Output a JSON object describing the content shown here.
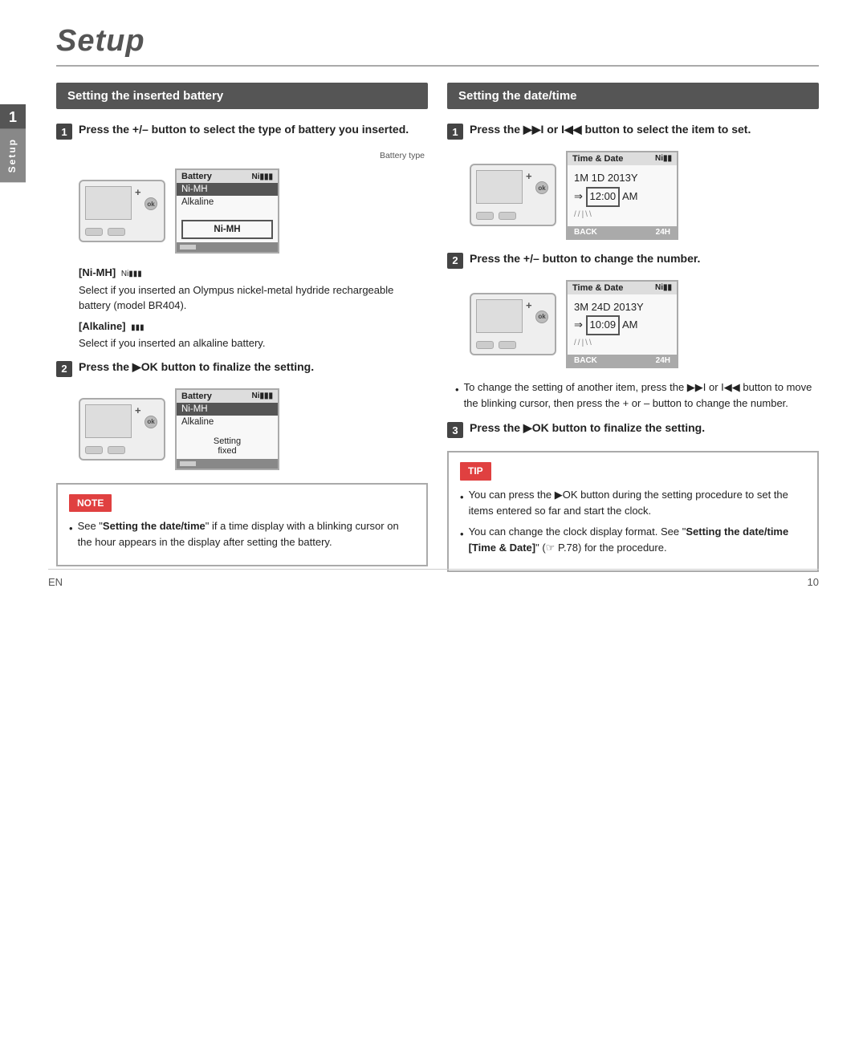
{
  "page": {
    "title": "Setup",
    "footer_lang": "EN",
    "footer_page": "10"
  },
  "side_tab": {
    "label": "Setup",
    "number": "1"
  },
  "left_section": {
    "header": "Setting the inserted battery",
    "step1": {
      "num": "1",
      "text": "Press the +/– button to select the type of battery you inserted."
    },
    "battery_type_label": "Battery type",
    "menu1": {
      "header": "Battery",
      "battery_icon": "Ni▮▮▮",
      "row1": "Ni-MH",
      "row2": "Alkaline",
      "highlighted": "Ni-MH"
    },
    "nimh_term": "[Ni-MH]",
    "nimh_icon": "Ni▮▮▮",
    "nimh_desc": "Select if you inserted an Olympus nickel-metal hydride rechargeable battery (model BR404).",
    "alkaline_term": "[Alkaline]",
    "alkaline_icon": "▮▮▮",
    "alkaline_desc": "Select if you inserted an alkaline battery.",
    "step2": {
      "num": "2",
      "text": "Press the ▶OK button to finalize the setting."
    },
    "menu2": {
      "header": "Battery",
      "battery_icon": "Ni▮▮▮",
      "row1": "Ni-MH",
      "row2": "Alkaline",
      "row3": "Setting",
      "row4": "fixed"
    },
    "note_label": "NOTE",
    "note_text": "See \"Setting the date/time\" if a time display with a blinking cursor on the hour appears in the display after setting the battery."
  },
  "right_section": {
    "header": "Setting the date/time",
    "step1": {
      "num": "1",
      "text": "Press the ▶▶I or I◀◀ button to select the item to set."
    },
    "td_screen1": {
      "header": "Time & Date",
      "battery_icon": "Ni▮▮",
      "date_row": "1M  1D  2013Y",
      "time_row_prefix": "⇒",
      "time_highlight": "12:00",
      "time_suffix": " AM",
      "back": "BACK",
      "h24": "24H"
    },
    "step2": {
      "num": "2",
      "text": "Press the +/– button to change the number."
    },
    "td_screen2": {
      "header": "Time & Date",
      "battery_icon": "Ni▮▮",
      "date_row": "3M  24D  2013Y",
      "time_row_prefix": "⇒",
      "time_highlight": "10:09",
      "time_suffix": " AM",
      "back": "BACK",
      "h24": "24H"
    },
    "change_note": "To change the setting of another item, press the ▶▶I or I◀◀ button to move the blinking cursor, then press the + or – button to change the number.",
    "step3": {
      "num": "3",
      "text": "Press the ▶OK button to finalize the setting."
    },
    "tip_label": "TIP",
    "tip_item1": "You can press the ▶OK button during the setting procedure to set the items entered so far and start the clock.",
    "tip_item2_pre": "You can change the clock display format. See \"",
    "tip_item2_bold": "Setting the date/time [Time & Date]",
    "tip_item2_post": "\" (☞ P.78) for the procedure."
  }
}
